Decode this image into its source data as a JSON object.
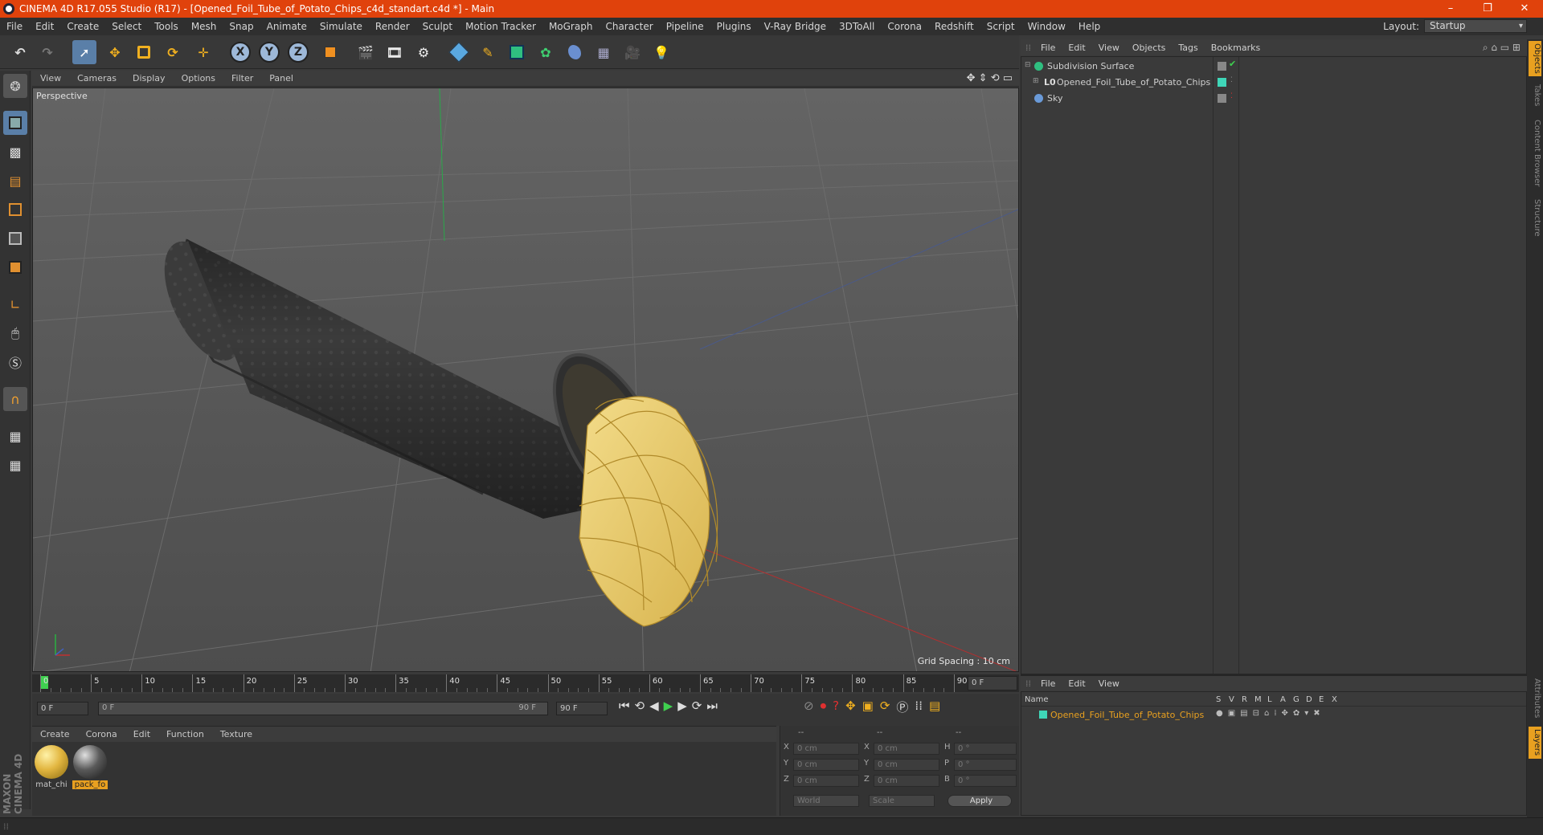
{
  "window": {
    "title": "CINEMA 4D R17.055 Studio (R17) - [Opened_Foil_Tube_of_Potato_Chips_c4d_standart.c4d *] - Main",
    "controls": [
      "–",
      "❐",
      "✕"
    ]
  },
  "menubar": {
    "items": [
      "File",
      "Edit",
      "Create",
      "Select",
      "Tools",
      "Mesh",
      "Snap",
      "Animate",
      "Simulate",
      "Render",
      "Sculpt",
      "Motion Tracker",
      "MoGraph",
      "Character",
      "Pipeline",
      "Plugins",
      "V-Ray Bridge",
      "3DToAll",
      "Corona",
      "Redshift",
      "Script",
      "Window",
      "Help"
    ],
    "layout_label": "Layout:",
    "layout_value": "Startup"
  },
  "toolbar": {
    "axis_x": "X",
    "axis_y": "Y",
    "axis_z": "Z"
  },
  "viewport": {
    "menu": [
      "View",
      "Cameras",
      "Display",
      "Options",
      "Filter",
      "Panel"
    ],
    "label": "Perspective",
    "grid_spacing": "Grid Spacing : 10 cm"
  },
  "timeline": {
    "ticks": [
      "0",
      "5",
      "10",
      "15",
      "20",
      "25",
      "30",
      "35",
      "40",
      "45",
      "50",
      "55",
      "60",
      "65",
      "70",
      "75",
      "80",
      "85",
      "90"
    ],
    "current_frame": "0 F",
    "start_field": "0 F",
    "range_start": "0 F",
    "range_end": "90 F",
    "end_field": "90 F"
  },
  "materials": {
    "menu": [
      "Create",
      "Corona",
      "Edit",
      "Function",
      "Texture"
    ],
    "items": [
      {
        "name": "mat_chi",
        "color": "#e2b640"
      },
      {
        "name": "pack_fo",
        "color": "#5a5a5a"
      }
    ]
  },
  "coords": {
    "headers": [
      "--",
      "--",
      "--"
    ],
    "rows": [
      {
        "l1": "X",
        "v1": "0 cm",
        "l2": "X",
        "v2": "0 cm",
        "l3": "H",
        "v3": "0 °"
      },
      {
        "l1": "Y",
        "v1": "0 cm",
        "l2": "Y",
        "v2": "0 cm",
        "l3": "P",
        "v3": "0 °"
      },
      {
        "l1": "Z",
        "v1": "0 cm",
        "l2": "Z",
        "v2": "0 cm",
        "l3": "B",
        "v3": "0 °"
      }
    ],
    "world": "World",
    "scale": "Scale",
    "apply": "Apply"
  },
  "object_manager": {
    "menu": [
      "File",
      "Edit",
      "View",
      "Objects",
      "Tags",
      "Bookmarks"
    ],
    "objects": [
      {
        "name": "Subdivision Surface",
        "icon": "subdivision-icon"
      },
      {
        "name": "Opened_Foil_Tube_of_Potato_Chips",
        "icon": "null-object-icon"
      },
      {
        "name": "Sky",
        "icon": "sky-icon"
      }
    ]
  },
  "layer_manager": {
    "menu": [
      "File",
      "Edit",
      "View"
    ],
    "header_name": "Name",
    "header_cols": [
      "S",
      "V",
      "R",
      "M",
      "L",
      "A",
      "G",
      "D",
      "E",
      "X"
    ],
    "layers": [
      {
        "name": "Opened_Foil_Tube_of_Potato_Chips",
        "color": "#3fd6b8"
      }
    ]
  },
  "side_tabs": [
    "Objects",
    "Takes",
    "Content Browser",
    "Structure",
    "Attributes",
    "Layers"
  ],
  "brand": "MAXON CINEMA 4D"
}
